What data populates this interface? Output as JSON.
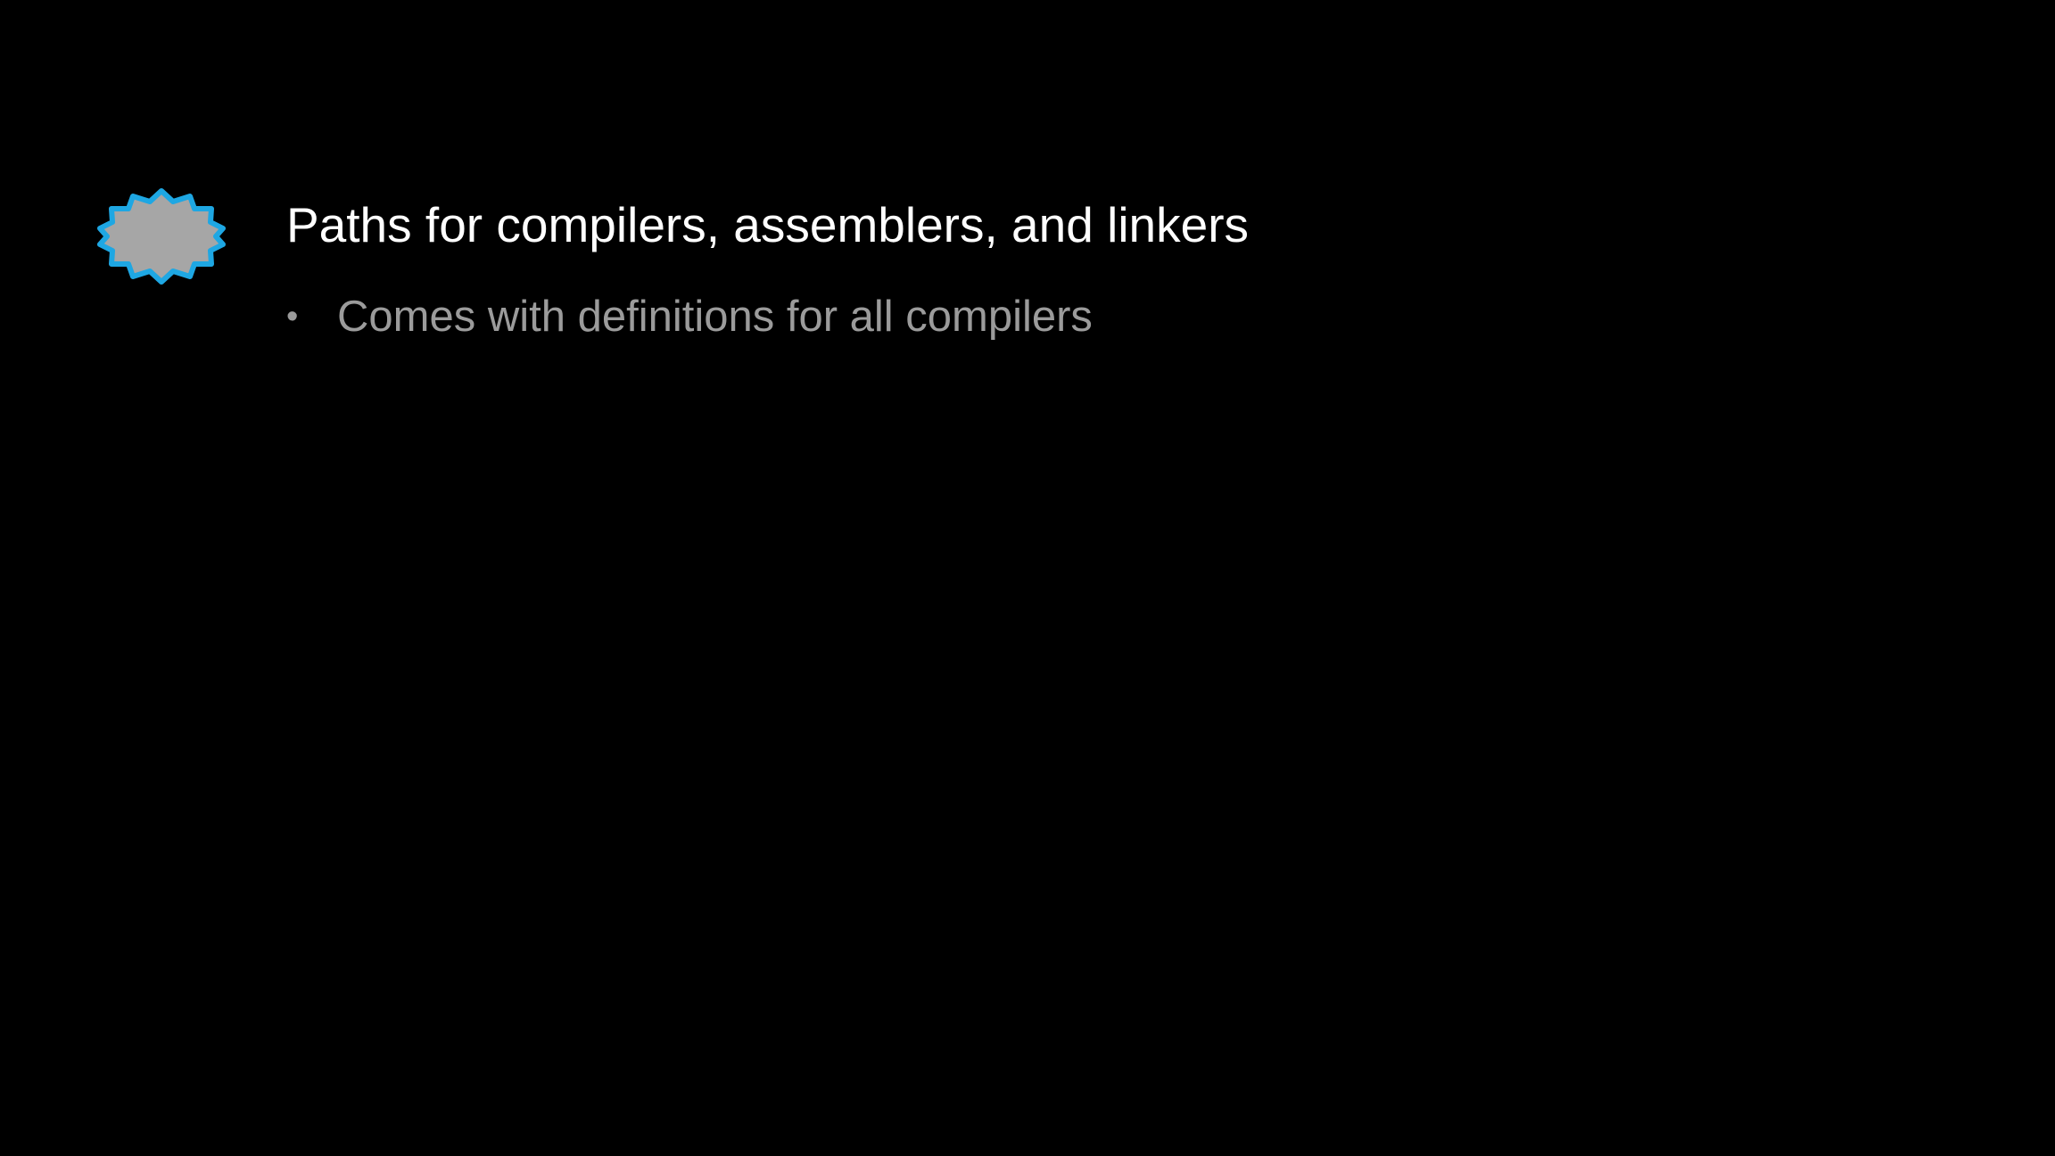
{
  "slide": {
    "heading": "Paths for compilers, assemblers, and linkers",
    "bullets": [
      {
        "marker": "•",
        "text": "Comes with definitions for all compilers"
      }
    ]
  },
  "icon": {
    "name": "starburst-badge-icon",
    "fill_color": "#a6a6a6",
    "stroke_color": "#1ea7e3"
  },
  "colors": {
    "background": "#000000",
    "heading": "#ffffff",
    "bullet": "#9b9b9b"
  }
}
